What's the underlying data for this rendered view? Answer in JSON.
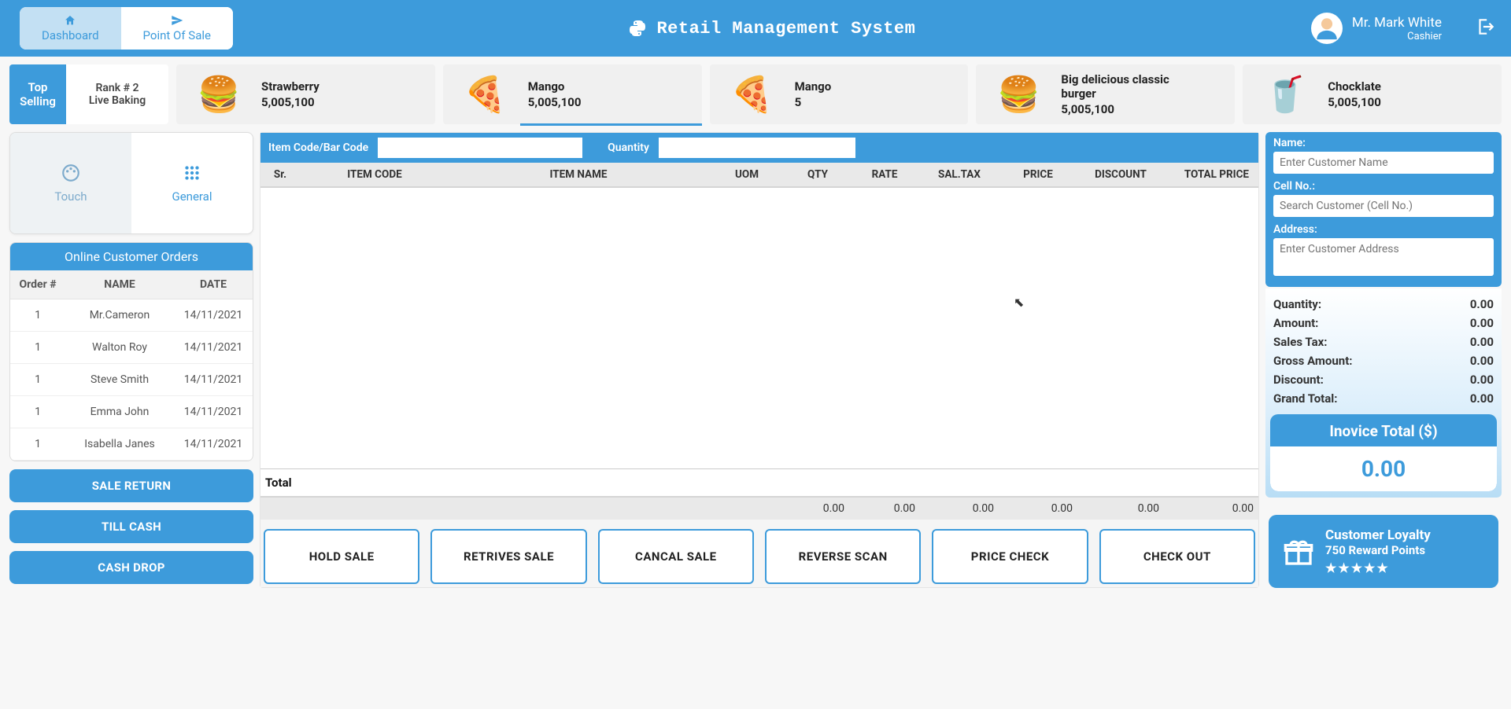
{
  "header": {
    "nav": {
      "dashboard": "Dashboard",
      "pos": "Point Of Sale"
    },
    "title": "Retail Management System",
    "user": {
      "name": "Mr. Mark White",
      "role": "Cashier"
    }
  },
  "topSelling": {
    "label1": "Top",
    "label2": "Selling",
    "rank_line1": "Rank # 2",
    "rank_line2": "Live Baking",
    "products": [
      {
        "name": "Strawberry",
        "price": "5,005,100"
      },
      {
        "name": "Mango",
        "price": "5,005,100"
      },
      {
        "name": "Mango",
        "price": "5"
      },
      {
        "name": "Big delicious classic burger",
        "price": "5,005,100"
      },
      {
        "name": "Chocklate",
        "price": "5,005,100"
      }
    ]
  },
  "modes": {
    "touch": "Touch",
    "general": "General"
  },
  "orders": {
    "title": "Online Customer Orders",
    "cols": {
      "order": "Order #",
      "name": "NAME",
      "date": "DATE"
    },
    "rows": [
      {
        "num": "1",
        "name": "Mr.Cameron",
        "date": "14/11/2021"
      },
      {
        "num": "1",
        "name": "Walton Roy",
        "date": "14/11/2021"
      },
      {
        "num": "1",
        "name": "Steve Smith",
        "date": "14/11/2021"
      },
      {
        "num": "1",
        "name": "Emma John",
        "date": "14/11/2021"
      },
      {
        "num": "1",
        "name": "Isabella Janes",
        "date": "14/11/2021"
      }
    ]
  },
  "leftButtons": {
    "saleReturn": "SALE RETURN",
    "tillCash": "TILL CASH",
    "cashDrop": "CASH DROP"
  },
  "center": {
    "codeLabel": "Item Code/Bar Code",
    "qtyLabel": "Quantity",
    "cols": {
      "sr": "Sr.",
      "code": "ITEM CODE",
      "name": "ITEM NAME",
      "uom": "UOM",
      "qty": "QTY",
      "rate": "RATE",
      "tax": "SAL.TAX",
      "price": "PRICE",
      "disc": "DISCOUNT",
      "total": "TOTAL PRICE"
    },
    "totalLabel": "Total",
    "totals": {
      "qty": "0.00",
      "rate": "0.00",
      "tax": "0.00",
      "price": "0.00",
      "disc": "0.00",
      "total": "0.00"
    },
    "actions": {
      "hold": "HOLD SALE",
      "retrive": "RETRIVES SALE",
      "cancel": "CANCAL SALE",
      "reverse": "REVERSE SCAN",
      "pricecheck": "PRICE CHECK",
      "checkout": "CHECK OUT"
    }
  },
  "customer": {
    "nameLabel": "Name:",
    "namePh": "Enter Customer Name",
    "cellLabel": "Cell No.:",
    "cellPh": "Search Customer (Cell No.)",
    "addrLabel": "Address:",
    "addrPh": "Enter Customer Address"
  },
  "summary": {
    "lines": [
      {
        "k": "Quantity:",
        "v": "0.00"
      },
      {
        "k": "Amount:",
        "v": "0.00"
      },
      {
        "k": "Sales Tax:",
        "v": "0.00"
      },
      {
        "k": "Gross Amount:",
        "v": "0.00"
      },
      {
        "k": "Discount:",
        "v": "0.00"
      },
      {
        "k": "Grand Total:",
        "v": "0.00"
      }
    ],
    "invoiceTitle": "Inovice Total ($)",
    "invoiceValue": "0.00"
  },
  "loyalty": {
    "title": "Customer Loyalty",
    "points": "750 Reward Points",
    "stars": "★★★★★"
  }
}
